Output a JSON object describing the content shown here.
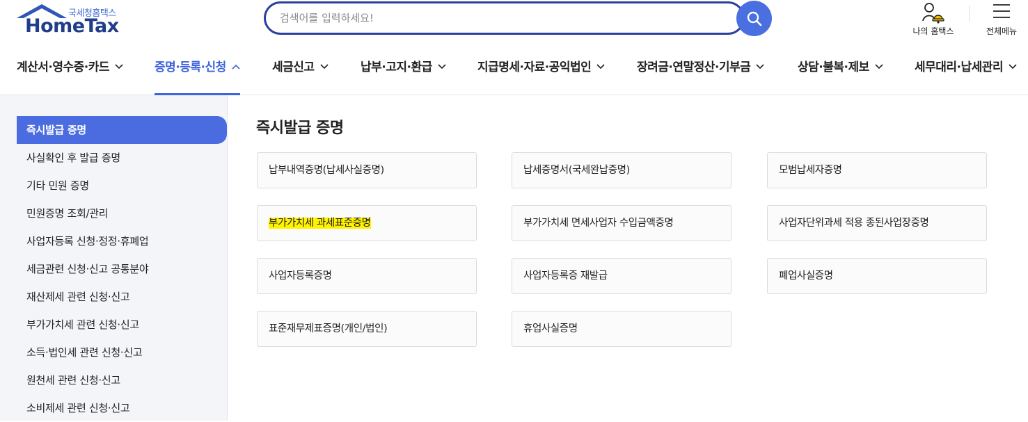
{
  "brand": {
    "sub": "국세청홈택스",
    "name": "HomeTax"
  },
  "search": {
    "placeholder": "검색어를 입력하세요!"
  },
  "utility": {
    "my_hometax": "나의 홈택스",
    "all_menu": "전체메뉴"
  },
  "gnb": [
    {
      "label": "계산서·영수증·카드",
      "active": false
    },
    {
      "label": "증명·등록·신청",
      "active": true
    },
    {
      "label": "세금신고",
      "active": false
    },
    {
      "label": "납부·고지·환급",
      "active": false
    },
    {
      "label": "지급명세·자료·공익법인",
      "active": false
    },
    {
      "label": "장려금·연말정산·기부금",
      "active": false
    },
    {
      "label": "상담·불복·제보",
      "active": false
    },
    {
      "label": "세무대리·납세관리",
      "active": false
    }
  ],
  "sidebar": {
    "items": [
      {
        "label": "즉시발급 증명",
        "active": true
      },
      {
        "label": "사실확인 후 발급 증명"
      },
      {
        "label": "기타 민원 증명"
      },
      {
        "label": "민원증명 조회/관리"
      },
      {
        "label": "사업자등록 신청·정정·휴폐업"
      },
      {
        "label": "세금관련 신청·신고 공통분야"
      },
      {
        "label": "재산제세 관련 신청·신고"
      },
      {
        "label": "부가가치세 관련 신청·신고"
      },
      {
        "label": "소득·법인세 관련 신청·신고"
      },
      {
        "label": "원천세 관련 신청·신고"
      },
      {
        "label": "소비제세 관련 신청·신고"
      }
    ]
  },
  "main": {
    "title": "즉시발급 증명",
    "cards": [
      {
        "label": "납부내역증명(납세사실증명)"
      },
      {
        "label": "납세증명서(국세완납증명)"
      },
      {
        "label": "모범납세자증명"
      },
      {
        "label": "부가가치세 과세표준증명",
        "highlighted": true
      },
      {
        "label": "부가가치세 면세사업자 수입금액증명"
      },
      {
        "label": "사업자단위과세 적용 종된사업장증명"
      },
      {
        "label": "사업자등록증명"
      },
      {
        "label": "사업자등록증 재발급"
      },
      {
        "label": "폐업사실증명"
      },
      {
        "label": "표준재무제표증명(개인/법인)"
      },
      {
        "label": "휴업사실증명"
      }
    ]
  },
  "colors": {
    "accent": "#4a6ce0",
    "brand_dark": "#203d8a",
    "highlight": "#fff200"
  }
}
